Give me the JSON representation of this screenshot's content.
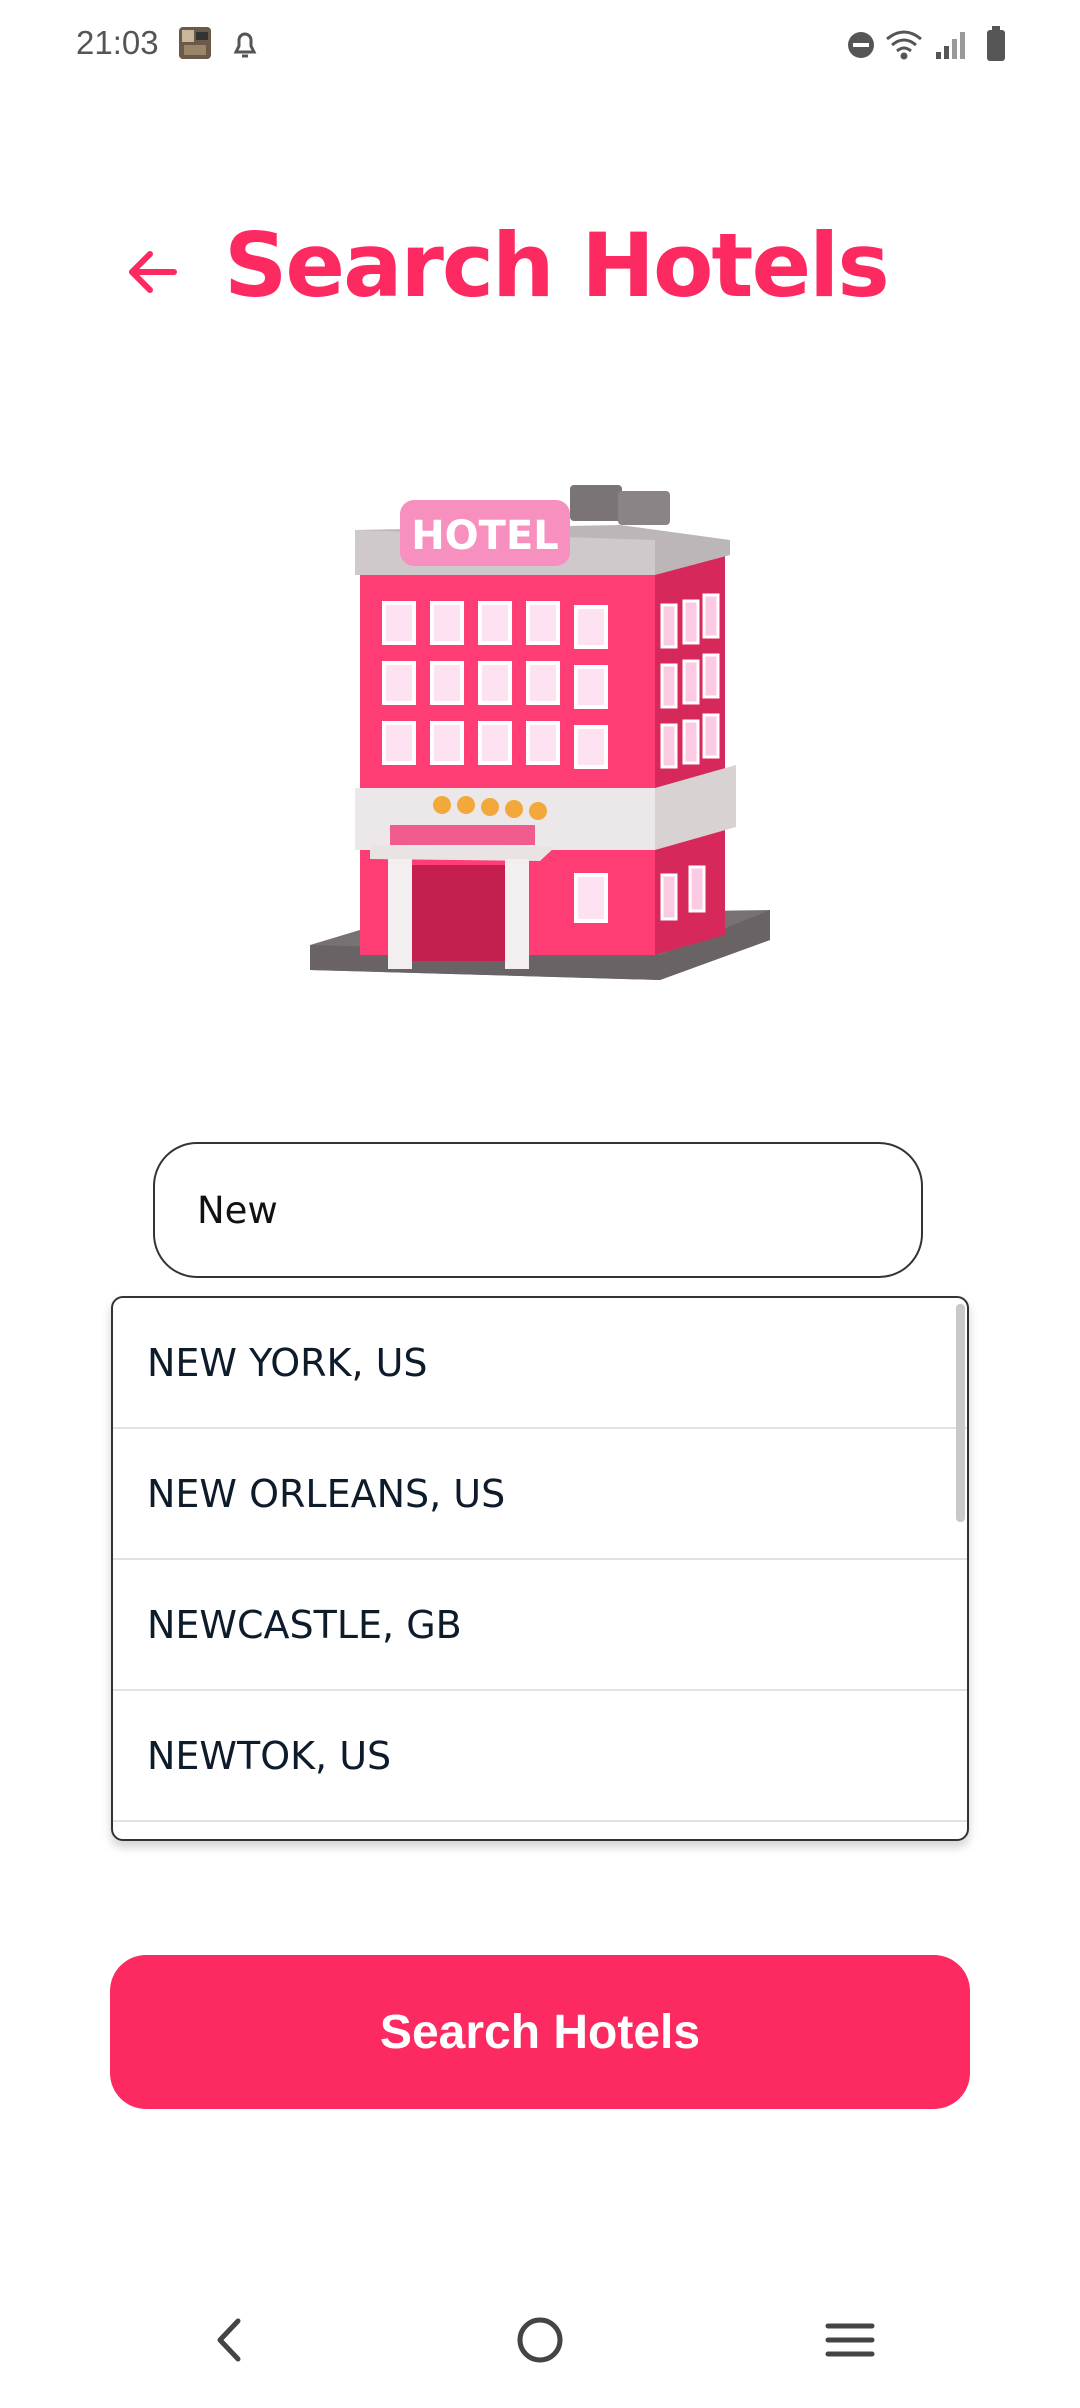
{
  "status_bar": {
    "time": "21:03",
    "icons": [
      "photo-thumbnail-icon",
      "notification-bell-icon",
      "do-not-disturb-icon",
      "wifi-icon",
      "signal-icon",
      "battery-icon"
    ]
  },
  "header": {
    "back_icon": "arrow-left-icon",
    "title": "Search Hotels"
  },
  "illustration": {
    "sign_text": "HOTEL",
    "description_icon": "hotel-building-icon"
  },
  "search": {
    "value": "New"
  },
  "suggestions": [
    {
      "label": "NEW YORK, US"
    },
    {
      "label": "NEW ORLEANS, US"
    },
    {
      "label": "NEWCASTLE, GB"
    },
    {
      "label": "NEWTOK, US"
    }
  ],
  "button": {
    "label": "Search Hotels"
  },
  "nav": {
    "back_icon": "nav-back-icon",
    "home_icon": "nav-home-icon",
    "menu_icon": "nav-menu-icon"
  },
  "colors": {
    "accent": "#fd2a61",
    "text_dark": "#0d1b2a"
  }
}
